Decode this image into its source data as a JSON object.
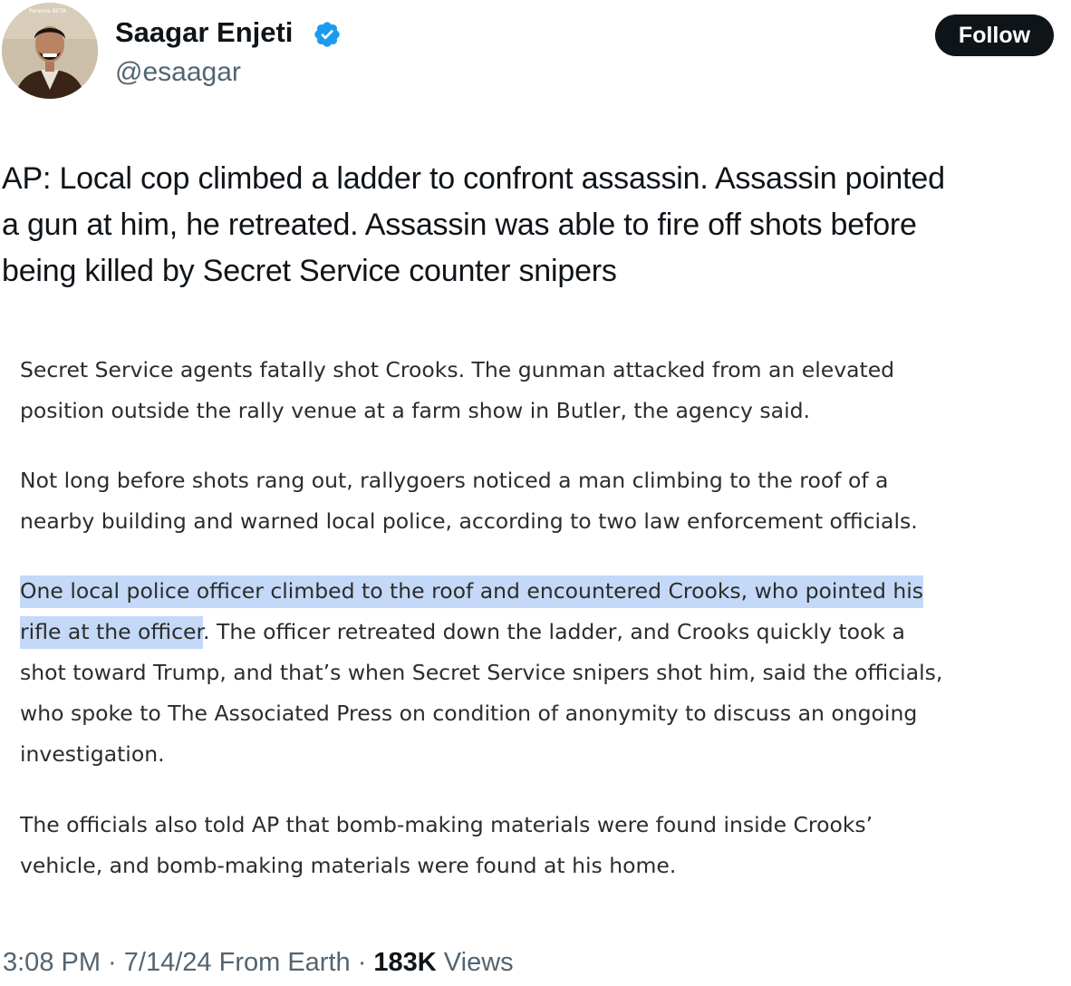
{
  "author": {
    "name": "Saagar Enjeti",
    "handle": "@esaagar",
    "avatar_badge": "Persona BETA",
    "verified_color": "#1d9bf0"
  },
  "follow_label": "Follow",
  "tweet": {
    "lines": [
      "AP: Local cop climbed a ladder to confront assassin. Assassin pointed",
      "a gun at him, he retreated. Assassin was able to fire off shots before",
      "being killed by Secret Service counter snipers"
    ]
  },
  "article": {
    "p1": [
      "Secret Service agents fatally shot Crooks. The gunman attacked from an elevated",
      "position outside the rally venue at a farm show in Butler, the agency said."
    ],
    "p2": [
      "Not long before shots rang out, rallygoers noticed a man climbing to the roof of a",
      "nearby building and warned local police, according to two law enforcement officials."
    ],
    "p3": {
      "line1_highlight": "One local police officer climbed to the roof and encountered Crooks, who pointed his",
      "line2_highlight": "rifle at the officer",
      "line2_rest": ". The officer retreated down the ladder, and Crooks quickly took a",
      "line3": "shot toward Trump, and that’s when Secret Service snipers shot him, said the officials,",
      "line4": "who spoke to The Associated Press on condition of anonymity to discuss an ongoing",
      "line5": "investigation."
    },
    "p4": [
      "The officials also told AP that bomb-making materials were found inside Crooks’",
      "vehicle, and bomb-making materials were found at his home."
    ],
    "highlight_color": "#c4d9f7"
  },
  "meta": {
    "time": "3:08 PM",
    "sep1": " · ",
    "date": "7/14/24",
    "source": " From Earth",
    "sep2": " · ",
    "views_count": "183K",
    "views_label": " Views"
  }
}
